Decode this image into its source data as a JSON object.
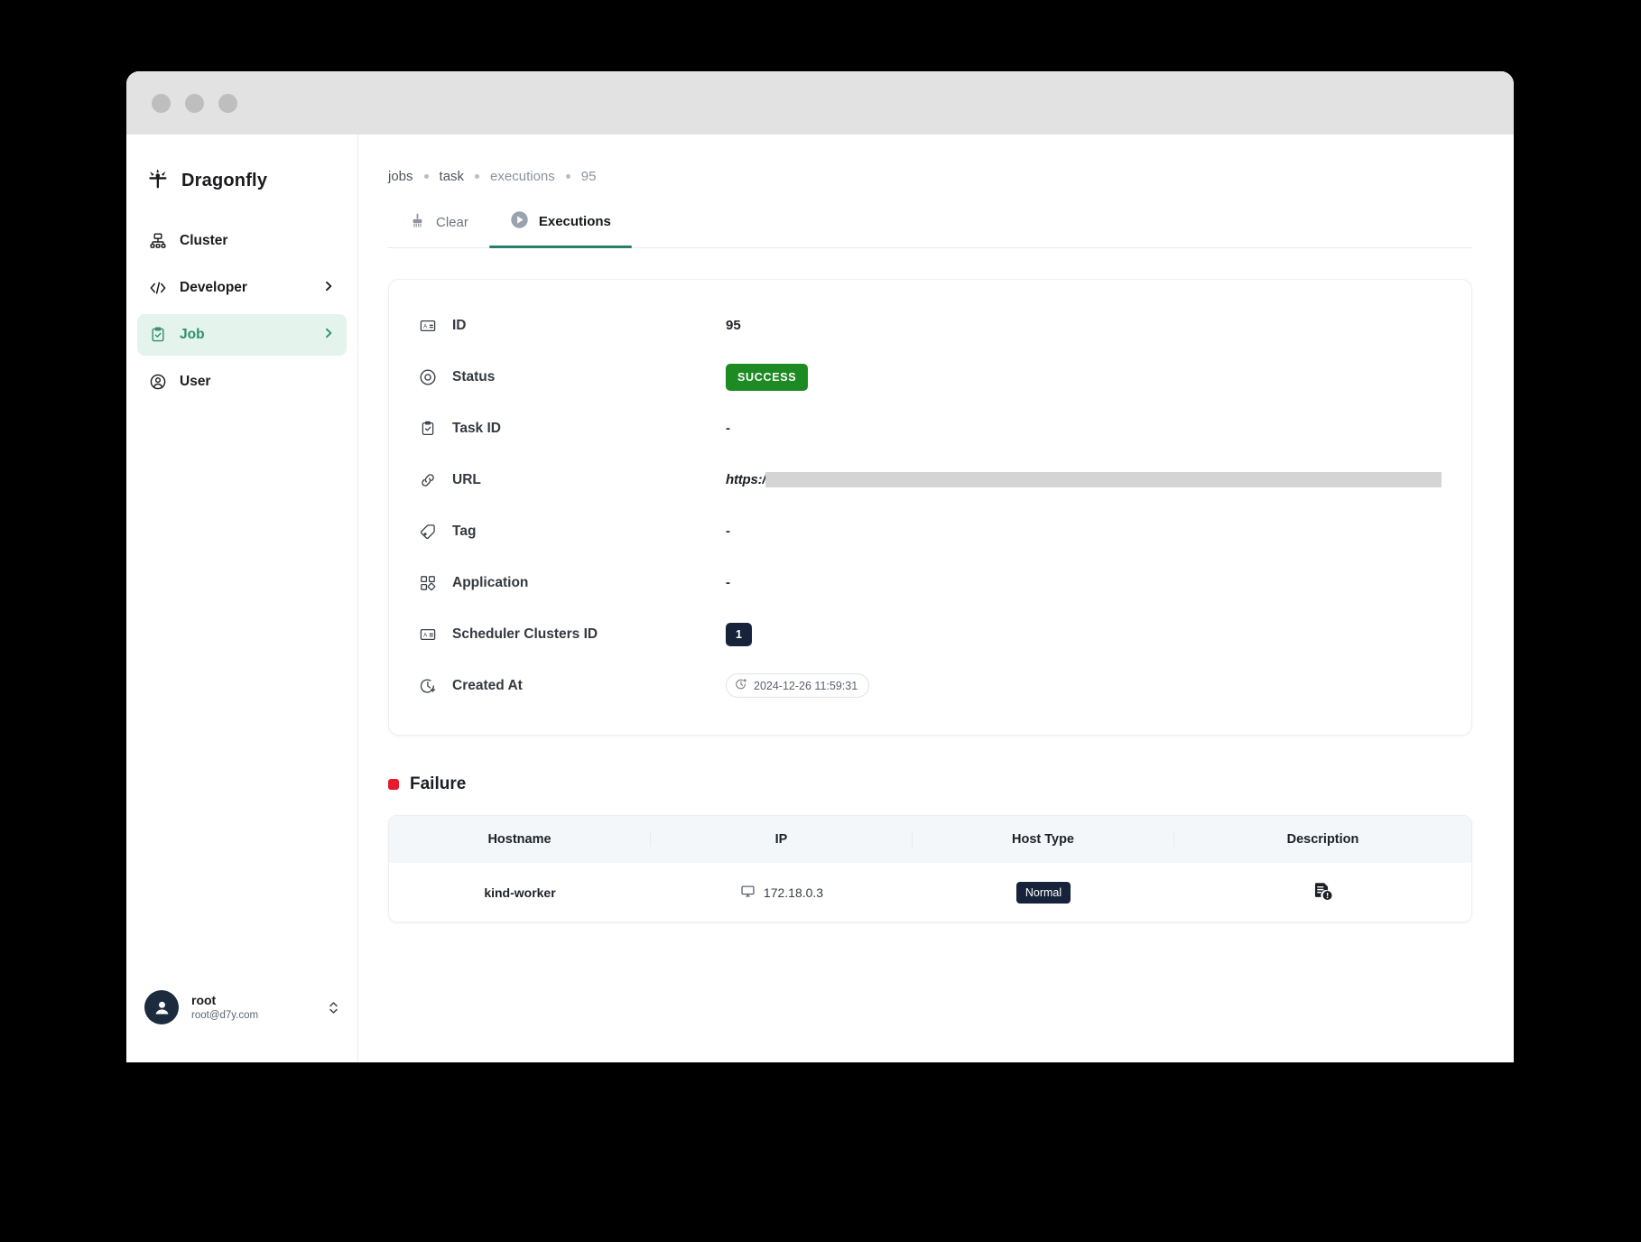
{
  "window": {
    "traffic_lights": [
      "close",
      "minimize",
      "maximize"
    ]
  },
  "sidebar": {
    "brand": {
      "name": "Dragonfly",
      "icon": "dragonfly-logo-icon"
    },
    "items": [
      {
        "label": "Cluster",
        "icon": "cluster-icon",
        "active": false,
        "has_chevron": false
      },
      {
        "label": "Developer",
        "icon": "code-icon",
        "active": false,
        "has_chevron": true
      },
      {
        "label": "Job",
        "icon": "clipboard-check-icon",
        "active": true,
        "has_chevron": true
      },
      {
        "label": "User",
        "icon": "user-circle-icon",
        "active": false,
        "has_chevron": false
      }
    ],
    "profile": {
      "name": "root",
      "email": "root@d7y.com",
      "avatar_icon": "avatar-person-icon",
      "switch_icon": "chevron-up-down-icon"
    }
  },
  "breadcrumb": {
    "items": [
      "jobs",
      "task",
      "executions",
      "95"
    ]
  },
  "tabs": [
    {
      "label": "Clear",
      "icon": "broom-icon",
      "active": false
    },
    {
      "label": "Executions",
      "icon": "play-circle-icon",
      "active": true
    }
  ],
  "details": {
    "rows": [
      {
        "label": "ID",
        "icon": "id-card-icon",
        "type": "text",
        "value": "95"
      },
      {
        "label": "Status",
        "icon": "status-circle-icon",
        "type": "badge-success",
        "value": "SUCCESS"
      },
      {
        "label": "Task ID",
        "icon": "clipboard-check-icon",
        "type": "text",
        "value": "-"
      },
      {
        "label": "URL",
        "icon": "link-icon",
        "type": "url-redacted",
        "value": "https:/"
      },
      {
        "label": "Tag",
        "icon": "tag-icon",
        "type": "text",
        "value": "-"
      },
      {
        "label": "Application",
        "icon": "apps-grid-icon",
        "type": "text",
        "value": "-"
      },
      {
        "label": "Scheduler Clusters ID",
        "icon": "id-card-icon",
        "type": "badge-dark",
        "value": "1"
      },
      {
        "label": "Created At",
        "icon": "clock-plus-icon",
        "type": "chip-time",
        "value": "2024-12-26 11:59:31"
      }
    ]
  },
  "failure": {
    "title": "Failure",
    "dot_color": "#e8192c",
    "table": {
      "headers": [
        "Hostname",
        "IP",
        "Host Type",
        "Description"
      ],
      "rows": [
        {
          "hostname": "kind-worker",
          "ip": "172.18.0.3",
          "ip_icon": "monitor-icon",
          "host_type": "Normal",
          "description_icon": "document-alert-icon"
        }
      ]
    }
  },
  "colors": {
    "accent_teal": "#2f8f6e",
    "success_green": "#1d8a23",
    "dark_navy": "#16233a",
    "failure_red": "#e8192c",
    "sidebar_active_bg": "#e4f3ec"
  }
}
